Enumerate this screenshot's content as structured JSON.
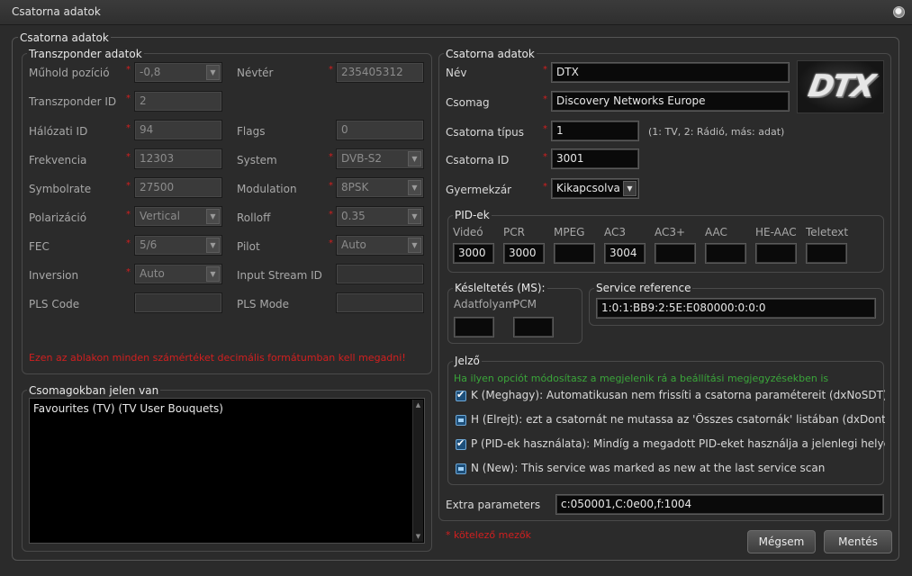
{
  "window": {
    "title": "Csatorna adatok"
  },
  "main_group_title": "Csatorna adatok",
  "transponder": {
    "title": "Transzponder adatok",
    "sat_pos_label": "Műhold pozíció",
    "sat_pos_value": "-0,8",
    "namespace_label": "Névtér",
    "namespace_value": "235405312",
    "tsid_label": "Transzponder ID",
    "tsid_value": "2",
    "onid_label": "Hálózati ID",
    "onid_value": "94",
    "flags_label": "Flags",
    "flags_value": "0",
    "freq_label": "Frekvencia",
    "freq_value": "12303",
    "system_label": "System",
    "system_value": "DVB-S2",
    "symbolrate_label": "Symbolrate",
    "symbolrate_value": "27500",
    "modulation_label": "Modulation",
    "modulation_value": "8PSK",
    "polarization_label": "Polarizáció",
    "polarization_value": "Vertical",
    "rolloff_label": "Rolloff",
    "rolloff_value": "0.35",
    "fec_label": "FEC",
    "fec_value": "5/6",
    "pilot_label": "Pilot",
    "pilot_value": "Auto",
    "inversion_label": "Inversion",
    "inversion_value": "Auto",
    "isid_label": "Input Stream ID",
    "isid_value": "",
    "pls_code_label": "PLS Code",
    "pls_code_value": "",
    "pls_mode_label": "PLS Mode",
    "pls_mode_value": "",
    "warning": "Ezen az ablakon minden számértéket decimális formátumban kell megadni!"
  },
  "packages": {
    "title": "Csomagokban jelen van",
    "items": [
      "Favourites (TV) (TV User Bouquets)"
    ]
  },
  "channel": {
    "title": "Csatorna adatok",
    "name_label": "Név",
    "name_value": "DTX",
    "package_label": "Csomag",
    "package_value": "Discovery Networks Europe",
    "type_label": "Csatorna típus",
    "type_value": "1",
    "type_hint": "(1: TV, 2: Rádió, más: adat)",
    "id_label": "Csatorna ID",
    "id_value": "3001",
    "parental_label": "Gyermekzár",
    "parental_value": "Kikapcsolva",
    "logo_text": "DTX"
  },
  "pids": {
    "title": "PID-ek",
    "items": [
      {
        "label": "Videó",
        "value": "3000"
      },
      {
        "label": "PCR",
        "value": "3000"
      },
      {
        "label": "MPEG",
        "value": ""
      },
      {
        "label": "AC3",
        "value": "3004"
      },
      {
        "label": "AC3+",
        "value": ""
      },
      {
        "label": "AAC",
        "value": ""
      },
      {
        "label": "HE-AAC",
        "value": ""
      },
      {
        "label": "Teletext",
        "value": ""
      }
    ]
  },
  "delay": {
    "title": "Késleltetés (MS):",
    "stream_label": "Adatfolyam",
    "stream_value": "",
    "pcm_label": "PCM",
    "pcm_value": ""
  },
  "service_ref": {
    "title": "Service reference",
    "value": "1:0:1:BB9:2:5E:E080000:0:0:0"
  },
  "flags": {
    "title": "Jelző",
    "hint": "Ha ilyen opciót módosítasz a megjelenik rá a beállítási megjegyzésekben is",
    "items": [
      {
        "checked": true,
        "label": "K (Meghagy): Automatikusan nem frissíti a csatorna paramétereit (dxNoSDT)"
      },
      {
        "checked": false,
        "label": "H (Elrejt): ezt a csatornát ne mutassa az 'Összes csatornák' listában (dxDontshow)"
      },
      {
        "checked": true,
        "label": "P (PID-ek használata): Mindíg a megadott PID-eket használja a jelenlegi helyett (dxNoDVB)"
      },
      {
        "checked": false,
        "label": "N (New): This service was marked as new at the last service scan"
      }
    ]
  },
  "extra": {
    "label": "Extra parameters",
    "value": "c:050001,C:0e00,f:1004"
  },
  "required_note": "* kötelező mezők",
  "buttons": {
    "cancel": "Mégsem",
    "save": "Mentés"
  },
  "colors": {
    "required": "#d21f1f",
    "hint": "#3aa63a",
    "field_dark": "#0a0a0a",
    "checkbox": "#1d4f7a"
  }
}
